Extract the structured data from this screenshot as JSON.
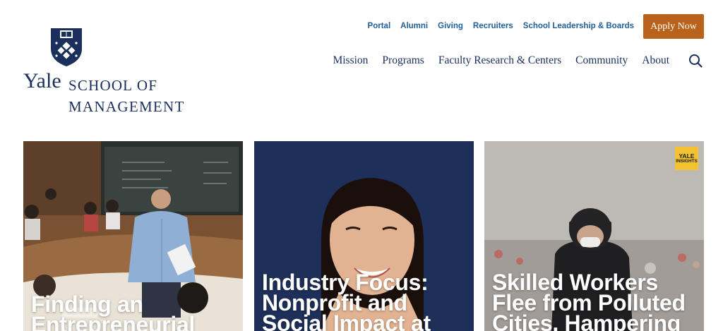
{
  "logo": {
    "yale": "Yale",
    "line1": "SCHOOL OF",
    "line2": "MANAGEMENT"
  },
  "utility_nav": [
    "Portal",
    "Alumni",
    "Giving",
    "Recruiters",
    "School Leadership & Boards"
  ],
  "apply_button": "Apply Now",
  "main_nav": [
    "Mission",
    "Programs",
    "Faculty Research & Centers",
    "Community",
    "About"
  ],
  "cards": [
    {
      "title": "Finding an Entrepreneurial"
    },
    {
      "title": "Industry Focus: Nonprofit and Social Impact at"
    },
    {
      "title": "Skilled Workers Flee from Polluted Cities, Hampering",
      "badge_line1": "YALE",
      "badge_line2": "INSIGHTS"
    }
  ],
  "colors": {
    "navy": "#1a2f5c",
    "link_blue": "#1f5f99",
    "accent_orange": "#b8621b",
    "badge_yellow": "#f2c230"
  }
}
